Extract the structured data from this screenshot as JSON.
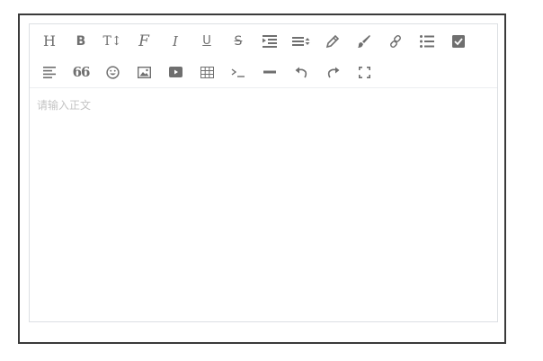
{
  "toolbar": {
    "row1": [
      {
        "name": "heading-button",
        "icon": "heading-icon",
        "glyph": "H"
      },
      {
        "name": "bold-button",
        "icon": "bold-icon",
        "glyph": "B"
      },
      {
        "name": "font-size-button",
        "icon": "font-size-icon",
        "glyph": "T↕"
      },
      {
        "name": "font-family-button",
        "icon": "font-family-icon",
        "glyph": "F"
      },
      {
        "name": "italic-button",
        "icon": "italic-icon",
        "glyph": "I"
      },
      {
        "name": "underline-button",
        "icon": "underline-icon",
        "glyph": "U"
      },
      {
        "name": "strikethrough-button",
        "icon": "strikethrough-icon",
        "glyph": "S"
      },
      {
        "name": "indent-button",
        "icon": "indent-icon"
      },
      {
        "name": "line-height-button",
        "icon": "line-height-icon"
      },
      {
        "name": "text-color-button",
        "icon": "pencil-icon"
      },
      {
        "name": "background-color-button",
        "icon": "brush-icon"
      },
      {
        "name": "link-button",
        "icon": "link-icon"
      },
      {
        "name": "list-button",
        "icon": "list-icon"
      },
      {
        "name": "todo-button",
        "icon": "checkbox-icon"
      }
    ],
    "row2": [
      {
        "name": "justify-button",
        "icon": "align-left-icon"
      },
      {
        "name": "quote-button",
        "icon": "quote-icon",
        "glyph": "66"
      },
      {
        "name": "emoticon-button",
        "icon": "smiley-icon"
      },
      {
        "name": "image-button",
        "icon": "image-icon"
      },
      {
        "name": "video-button",
        "icon": "video-icon"
      },
      {
        "name": "table-button",
        "icon": "table-icon"
      },
      {
        "name": "code-button",
        "icon": "code-icon"
      },
      {
        "name": "divider-button",
        "icon": "horizontal-rule-icon"
      },
      {
        "name": "undo-button",
        "icon": "undo-icon"
      },
      {
        "name": "redo-button",
        "icon": "redo-icon"
      },
      {
        "name": "fullscreen-button",
        "icon": "fullscreen-icon"
      }
    ]
  },
  "content": {
    "placeholder": "请输入正文"
  },
  "colors": {
    "icon": "#6f6f6f",
    "border": "#dcdfe3",
    "frame": "#3a3a3a",
    "placeholder": "#c4c4c4"
  }
}
